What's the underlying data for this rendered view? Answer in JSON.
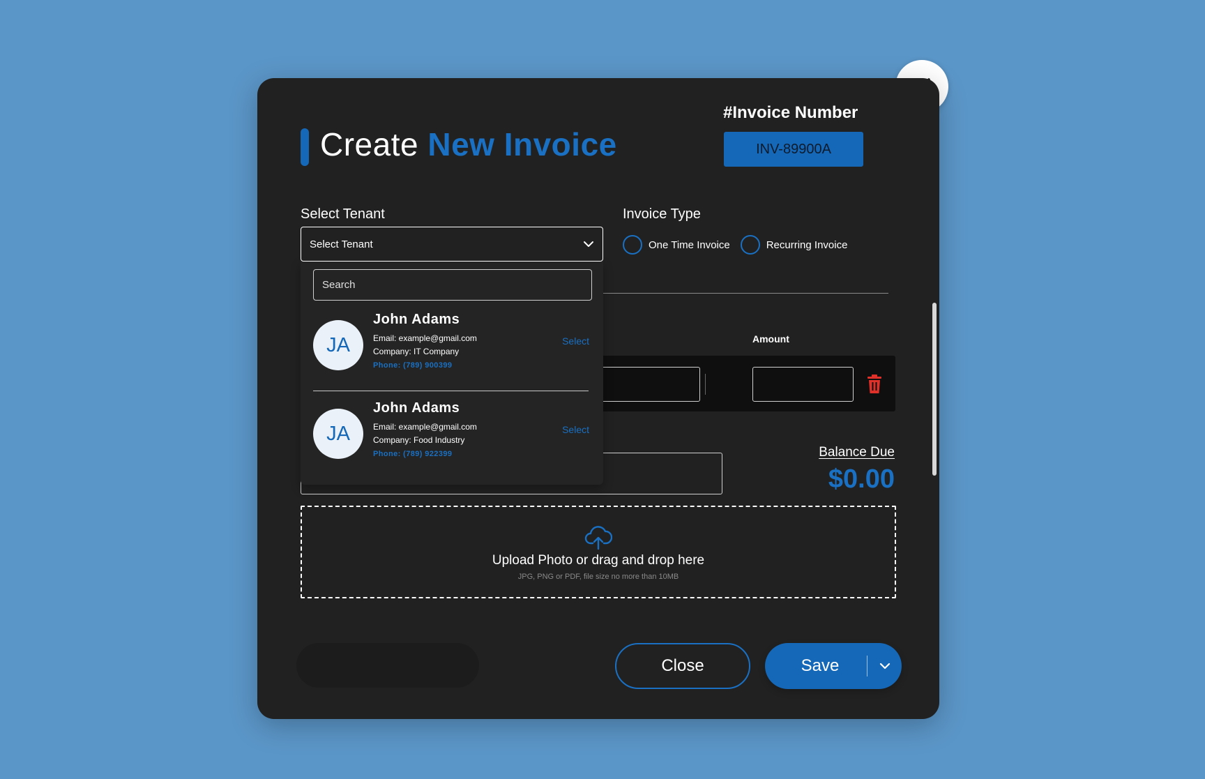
{
  "header": {
    "title_plain": "Create",
    "title_accent": "New Invoice",
    "invoice_label": "#Invoice Number",
    "invoice_number": "INV-89900A"
  },
  "tenant": {
    "label": "Select Tenant",
    "selected_value": "Select Tenant",
    "search_placeholder": "Search",
    "options": [
      {
        "initials": "JA",
        "name": "John Adams",
        "email": "Email: example@gmail.com",
        "company": "Company: IT Company",
        "phone": "Phone: (789) 900399",
        "action": "Select"
      },
      {
        "initials": "JA",
        "name": "John Adams",
        "email": "Email: example@gmail.com",
        "company": "Company: Food Industry",
        "phone": "Phone: (789) 922399",
        "action": "Select"
      }
    ]
  },
  "invoice_type": {
    "label": "Invoice Type",
    "options": [
      "One Time Invoice",
      "Recurring Invoice"
    ]
  },
  "items": {
    "amount_header": "Amount"
  },
  "balance": {
    "label": "Balance Due",
    "value": "$0.00"
  },
  "upload": {
    "title": "Upload Photo or drag and drop here",
    "subtitle": "JPG, PNG or PDF, file size no more than 10MB"
  },
  "footer": {
    "close_label": "Close",
    "save_label": "Save"
  },
  "colors": {
    "background": "#5b96c8",
    "modal": "#212121",
    "accent": "#1568b8",
    "danger": "#e0302a"
  }
}
